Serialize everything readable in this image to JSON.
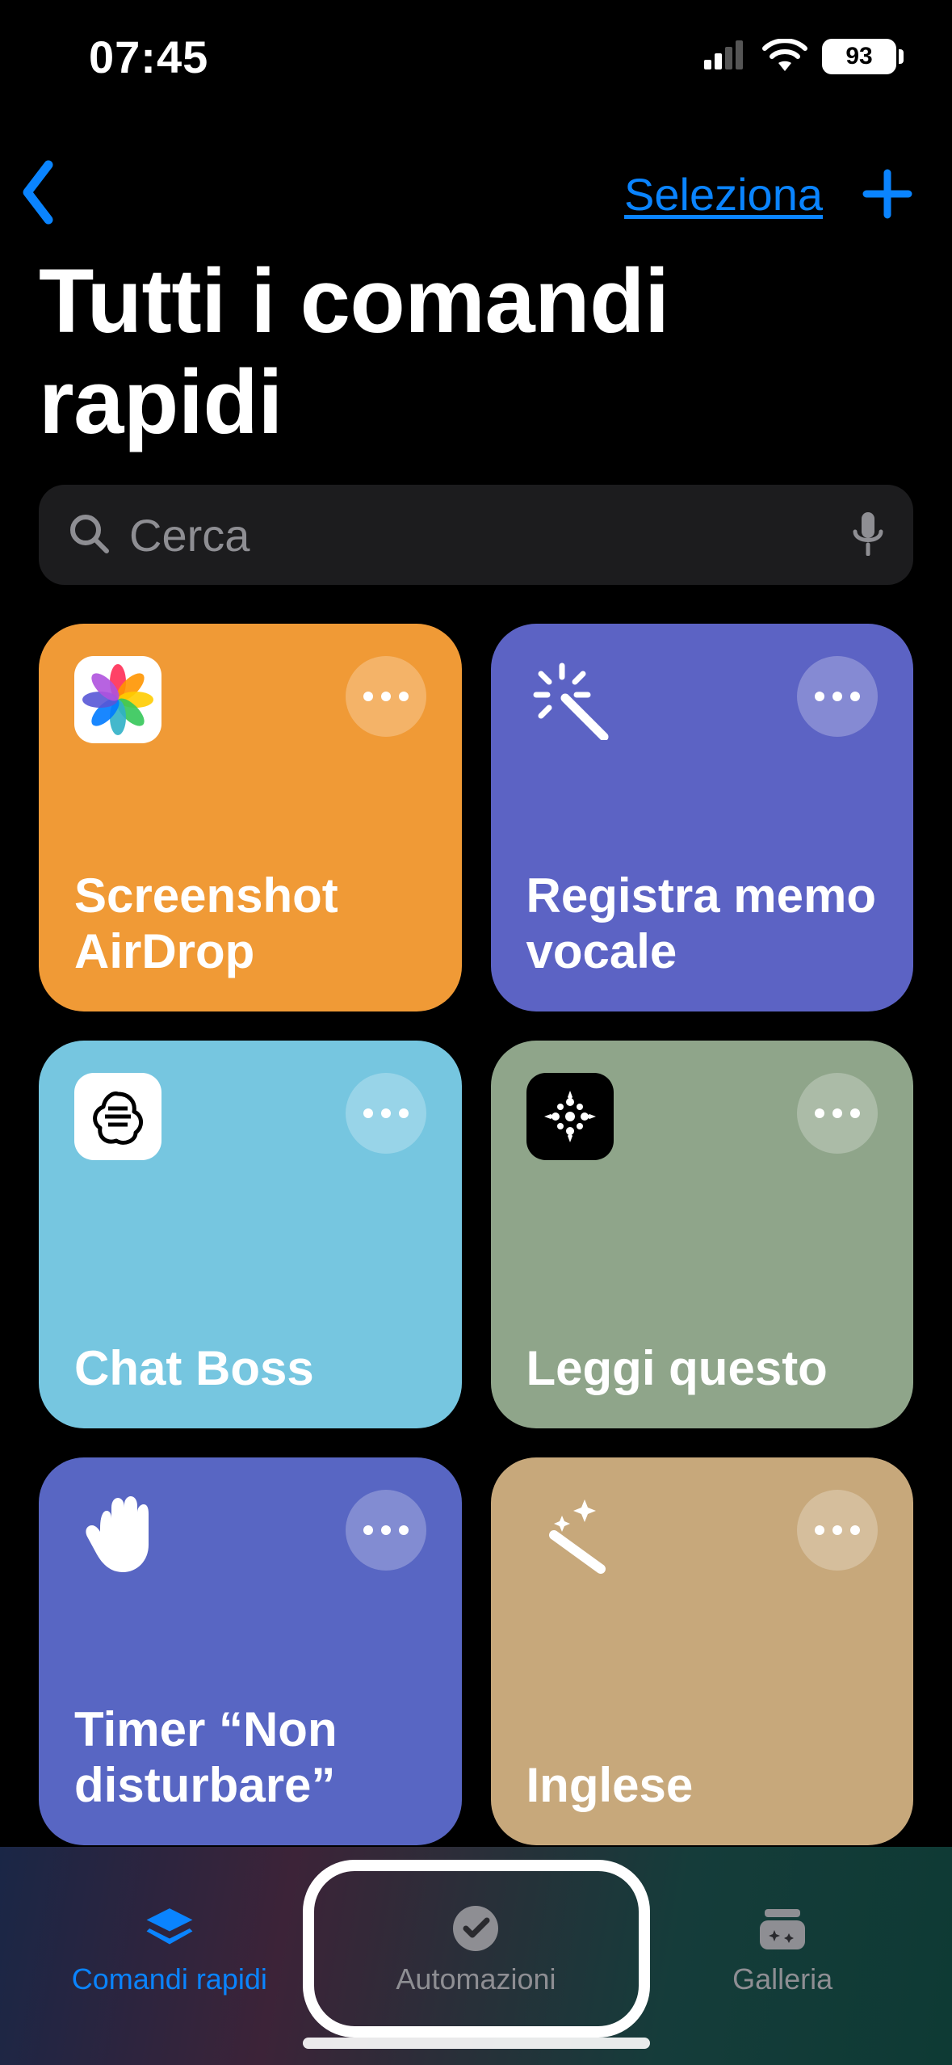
{
  "status": {
    "time": "07:45",
    "battery_pct": "93"
  },
  "nav": {
    "select_label": "Seleziona"
  },
  "title": "Tutti i comandi rapidi",
  "search": {
    "placeholder": "Cerca"
  },
  "tiles": [
    {
      "title": "Screenshot AirDrop",
      "bg": "bg-orange",
      "icon": "photos",
      "icon_bg": "white"
    },
    {
      "title": "Registra memo vocale",
      "bg": "bg-indigo",
      "icon": "wand-sparkle",
      "icon_bg": "none"
    },
    {
      "title": "Chat Boss",
      "bg": "bg-lightblue",
      "icon": "openai",
      "icon_bg": "white"
    },
    {
      "title": "Leggi questo",
      "bg": "bg-sage",
      "icon": "sparkle-grid",
      "icon_bg": "black"
    },
    {
      "title": "Timer “Non disturbare”",
      "bg": "bg-indigo2",
      "icon": "hand-stop",
      "icon_bg": "none"
    },
    {
      "title": "Inglese",
      "bg": "bg-tan",
      "icon": "wand-stars",
      "icon_bg": "none"
    }
  ],
  "tabs": [
    {
      "label": "Comandi rapidi",
      "icon": "layers-icon",
      "active": true
    },
    {
      "label": "Automazioni",
      "icon": "clock-check-icon",
      "active": false
    },
    {
      "label": "Galleria",
      "icon": "gallery-icon",
      "active": false
    }
  ]
}
